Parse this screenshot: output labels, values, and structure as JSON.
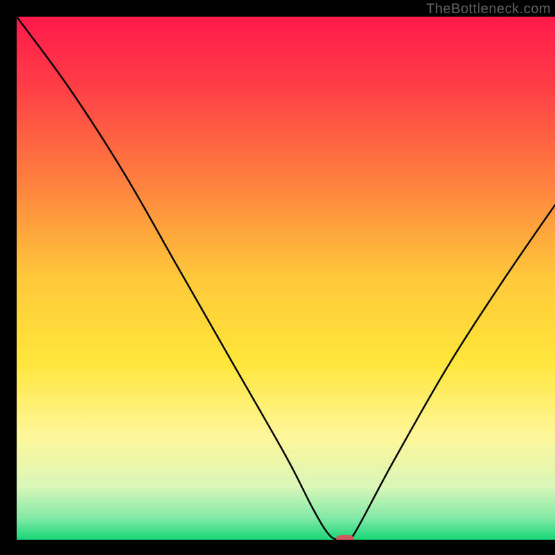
{
  "watermark": "TheBottleneck.com",
  "chart_data": {
    "type": "line",
    "title": "",
    "xlabel": "",
    "ylabel": "",
    "xlim": [
      0,
      100
    ],
    "ylim": [
      0,
      100
    ],
    "series": [
      {
        "name": "bottleneck-curve",
        "x": [
          0,
          10,
          20,
          30,
          40,
          50,
          55,
          58,
          60,
          62,
          70,
          80,
          90,
          100
        ],
        "values": [
          100,
          86,
          70,
          52,
          34,
          16,
          6,
          1,
          0,
          0,
          15,
          33,
          49,
          64
        ]
      }
    ],
    "marker": {
      "x": 61,
      "y": 0,
      "color": "#cf5a5e"
    },
    "gradient_stops": [
      {
        "offset": 0.0,
        "color": "#ff1a4b"
      },
      {
        "offset": 0.12,
        "color": "#ff3a47"
      },
      {
        "offset": 0.3,
        "color": "#ff7a3e"
      },
      {
        "offset": 0.5,
        "color": "#ffc93a"
      },
      {
        "offset": 0.66,
        "color": "#ffe63a"
      },
      {
        "offset": 0.8,
        "color": "#fff799"
      },
      {
        "offset": 0.9,
        "color": "#d8f7b8"
      },
      {
        "offset": 0.96,
        "color": "#7fe9a6"
      },
      {
        "offset": 1.0,
        "color": "#18d676"
      }
    ]
  }
}
